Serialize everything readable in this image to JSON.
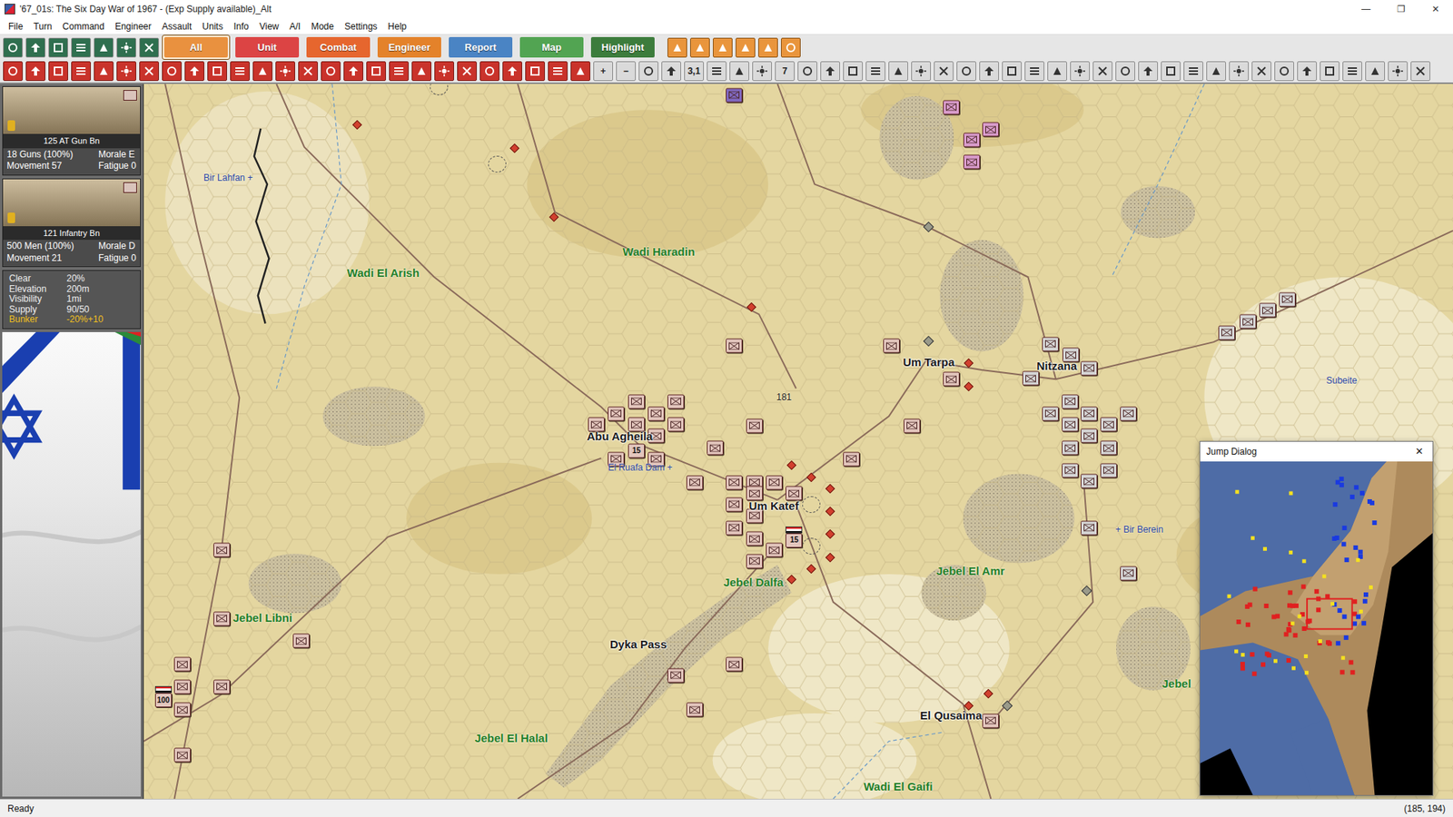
{
  "window": {
    "title": "'67_01s: The Six Day War of 1967 - (Exp Supply available)_Alt",
    "controls": [
      "—",
      "❐",
      "✕"
    ]
  },
  "menu": [
    "File",
    "Turn",
    "Command",
    "Engineer",
    "Assault",
    "Units",
    "Info",
    "View",
    "A/I",
    "Mode",
    "Settings",
    "Help"
  ],
  "tabs": [
    {
      "label": "All",
      "selected": true,
      "color": "#e9913f"
    },
    {
      "label": "Unit",
      "selected": false,
      "color": "#dc4444"
    },
    {
      "label": "Combat",
      "selected": false,
      "color": "#e6662e"
    },
    {
      "label": "Engineer",
      "selected": false,
      "color": "#e4822a"
    },
    {
      "label": "Report",
      "selected": false,
      "color": "#4a84c4"
    },
    {
      "label": "Map",
      "selected": false,
      "color": "#52a452"
    },
    {
      "label": "Highlight",
      "selected": false,
      "color": "#3c7c3c"
    }
  ],
  "toolbar2": [
    {
      "kind": "red"
    },
    {
      "kind": "red"
    },
    {
      "kind": "red"
    },
    {
      "kind": "red"
    },
    {
      "kind": "red"
    },
    {
      "kind": "red"
    },
    {
      "kind": "red"
    },
    {
      "kind": "red"
    },
    {
      "kind": "red"
    },
    {
      "kind": "red"
    },
    {
      "kind": "red"
    },
    {
      "kind": "red"
    },
    {
      "kind": "red"
    },
    {
      "kind": "red"
    },
    {
      "kind": "red"
    },
    {
      "kind": "red"
    },
    {
      "kind": "red"
    },
    {
      "kind": "red"
    },
    {
      "kind": "red"
    },
    {
      "kind": "red"
    },
    {
      "kind": "red"
    },
    {
      "kind": "red"
    },
    {
      "kind": "red"
    },
    {
      "kind": "red"
    },
    {
      "kind": "red"
    },
    {
      "kind": "red"
    },
    {
      "kind": "text",
      "label": "+"
    },
    {
      "kind": "text",
      "label": "−"
    },
    {
      "kind": "grey"
    },
    {
      "kind": "grey"
    },
    {
      "kind": "text",
      "label": "3,1"
    },
    {
      "kind": "grey"
    },
    {
      "kind": "grey"
    },
    {
      "kind": "grey"
    },
    {
      "kind": "text",
      "label": "7"
    },
    {
      "kind": "grey"
    },
    {
      "kind": "grey"
    },
    {
      "kind": "grey"
    },
    {
      "kind": "grey"
    },
    {
      "kind": "grey"
    },
    {
      "kind": "grey"
    },
    {
      "kind": "grey"
    },
    {
      "kind": "grey"
    },
    {
      "kind": "grey"
    },
    {
      "kind": "grey"
    },
    {
      "kind": "grey"
    },
    {
      "kind": "grey"
    },
    {
      "kind": "grey"
    },
    {
      "kind": "grey"
    },
    {
      "kind": "grey"
    },
    {
      "kind": "grey"
    },
    {
      "kind": "grey"
    },
    {
      "kind": "grey"
    },
    {
      "kind": "grey"
    },
    {
      "kind": "grey"
    },
    {
      "kind": "grey"
    },
    {
      "kind": "grey"
    },
    {
      "kind": "grey"
    },
    {
      "kind": "grey"
    },
    {
      "kind": "grey"
    },
    {
      "kind": "grey"
    },
    {
      "kind": "grey"
    },
    {
      "kind": "grey"
    }
  ],
  "unit_cards": [
    {
      "name": "125 AT Gun Bn",
      "strength": "18 Guns (100%)",
      "morale": "Morale E",
      "movement": "Movement 57",
      "fatigue": "Fatigue 0"
    },
    {
      "name": "121 Infantry Bn",
      "strength": "500 Men (100%)",
      "morale": "Morale D",
      "movement": "Movement 21",
      "fatigue": "Fatigue 0"
    }
  ],
  "hex_info": [
    {
      "label": "Clear",
      "value": "20%",
      "highlight": false
    },
    {
      "label": "Elevation",
      "value": "200m",
      "highlight": false
    },
    {
      "label": "Visibility",
      "value": "1mi",
      "highlight": false
    },
    {
      "label": "Supply",
      "value": "90/50",
      "highlight": false
    },
    {
      "label": "Bunker",
      "value": "-20%+10",
      "highlight": true
    }
  ],
  "map": {
    "labels": [
      {
        "text": "Bir Lahfan +",
        "kind": "site"
      },
      {
        "text": "Wadi El Arish",
        "kind": "terrain"
      },
      {
        "text": "Wadi Haradin",
        "kind": "terrain"
      },
      {
        "text": "Um Tarpa",
        "kind": "town"
      },
      {
        "text": "Nitzana",
        "kind": "town"
      },
      {
        "text": "Subeite",
        "kind": "site"
      },
      {
        "text": "Abu Agheila",
        "kind": "town"
      },
      {
        "text": "El Ruafa Dam +",
        "kind": "site"
      },
      {
        "text": "Um Katef",
        "kind": "town"
      },
      {
        "text": "181",
        "kind": "spot"
      },
      {
        "text": "+ Bir Berein",
        "kind": "site"
      },
      {
        "text": "Jebel El Amr",
        "kind": "terrain"
      },
      {
        "text": "Jebel Dalfa",
        "kind": "terrain"
      },
      {
        "text": "Jebel Libni",
        "kind": "terrain"
      },
      {
        "text": "Dyka Pass",
        "kind": "town"
      },
      {
        "text": "Jebel El Halal",
        "kind": "terrain"
      },
      {
        "text": "El Qusaima",
        "kind": "town"
      },
      {
        "text": "Wadi El Gaifi",
        "kind": "terrain"
      },
      {
        "text": "Jebel",
        "kind": "terrain"
      }
    ],
    "units": [
      {
        "kind": "unit",
        "color": "#8068c0"
      },
      {
        "kind": "unit",
        "color": "#d99ccc"
      },
      {
        "kind": "unit",
        "color": "#d99ccc"
      },
      {
        "kind": "unit",
        "color": "#d99ccc"
      },
      {
        "kind": "unit",
        "color": "#d99ccc"
      },
      {
        "kind": "unit",
        "color": "#e3c6bd"
      },
      {
        "kind": "unit",
        "color": "#e3c6bd"
      },
      {
        "kind": "unit",
        "color": "#e3c6bd"
      },
      {
        "kind": "unit",
        "color": "#e3c6bd"
      },
      {
        "kind": "unit",
        "color": "#e3c6bd"
      },
      {
        "kind": "unit",
        "color": "#e3c6bd"
      },
      {
        "kind": "unit",
        "color": "#e3c6bd"
      },
      {
        "kind": "unit",
        "color": "#e3c6bd"
      },
      {
        "kind": "unit",
        "color": "#e3c6bd"
      },
      {
        "kind": "unit",
        "color": "#e3c6bd"
      },
      {
        "kind": "unit",
        "color": "#e3c6bd"
      },
      {
        "kind": "unit",
        "color": "#e3c6bd"
      },
      {
        "kind": "unit",
        "color": "#e3c6bd"
      },
      {
        "kind": "unit",
        "color": "#e3c6bd"
      },
      {
        "kind": "unit",
        "color": "#e3c6bd"
      },
      {
        "kind": "unit",
        "color": "#e3c6bd"
      },
      {
        "kind": "unit",
        "color": "#e3c6bd",
        "label": "15"
      },
      {
        "kind": "unit",
        "color": "#e3c6bd"
      },
      {
        "kind": "unit",
        "color": "#e3c6bd"
      },
      {
        "kind": "unit",
        "color": "#e3c6bd"
      },
      {
        "kind": "unit",
        "color": "#e3c6bd"
      },
      {
        "kind": "unit",
        "color": "#e3c6bd"
      },
      {
        "kind": "unit",
        "color": "#e3c6bd"
      },
      {
        "kind": "unit",
        "color": "#e3c6bd"
      },
      {
        "kind": "unit",
        "color": "#e3c6bd"
      },
      {
        "kind": "unit",
        "color": "#e3c6bd"
      },
      {
        "kind": "unit",
        "color": "#e3c6bd"
      },
      {
        "kind": "unit",
        "color": "#e3c6bd"
      },
      {
        "kind": "unit",
        "color": "#e3c6bd"
      },
      {
        "kind": "unit",
        "color": "#e3c6bd"
      },
      {
        "kind": "hq",
        "color": "#e3c6bd",
        "label": "15"
      },
      {
        "kind": "unit",
        "color": "#d6d6d6"
      },
      {
        "kind": "unit",
        "color": "#d6d6d6"
      },
      {
        "kind": "unit",
        "color": "#d6d6d6"
      },
      {
        "kind": "unit",
        "color": "#d6d6d6"
      },
      {
        "kind": "unit",
        "color": "#d6d6d6"
      },
      {
        "kind": "unit",
        "color": "#d6d6d6"
      },
      {
        "kind": "unit",
        "color": "#d6d6d6"
      },
      {
        "kind": "unit",
        "color": "#d6d6d6"
      },
      {
        "kind": "unit",
        "color": "#d6d6d6"
      },
      {
        "kind": "unit",
        "color": "#d6d6d6"
      },
      {
        "kind": "unit",
        "color": "#d6d6d6"
      },
      {
        "kind": "unit",
        "color": "#d6d6d6"
      },
      {
        "kind": "unit",
        "color": "#d6d6d6"
      },
      {
        "kind": "unit",
        "color": "#d6d6d6"
      },
      {
        "kind": "unit",
        "color": "#d6d6d6"
      },
      {
        "kind": "unit",
        "color": "#d6d6d6"
      },
      {
        "kind": "unit",
        "color": "#d6d6d6"
      },
      {
        "kind": "unit",
        "color": "#d6d6d6"
      },
      {
        "kind": "unit",
        "color": "#d6d6d6"
      },
      {
        "kind": "unit",
        "color": "#d6d6d6"
      },
      {
        "kind": "unit",
        "color": "#d6d6d6"
      },
      {
        "kind": "unit",
        "color": "#d6d6d6"
      },
      {
        "kind": "unit",
        "color": "#e3c6bd"
      },
      {
        "kind": "unit",
        "color": "#e3c6bd"
      },
      {
        "kind": "unit",
        "color": "#e3c6bd"
      },
      {
        "kind": "unit",
        "color": "#e3c6bd"
      },
      {
        "kind": "unit",
        "color": "#e3c6bd"
      },
      {
        "kind": "unit",
        "color": "#e3c6bd"
      },
      {
        "kind": "unit",
        "color": "#e3c6bd"
      },
      {
        "kind": "unit",
        "color": "#e3c6bd"
      },
      {
        "kind": "hq",
        "color": "#e3c6bd",
        "label": "100"
      },
      {
        "kind": "unit",
        "color": "#e3c6bd"
      },
      {
        "kind": "unit",
        "color": "#e3c6bd"
      },
      {
        "kind": "unit",
        "color": "#e3c6bd"
      },
      {
        "kind": "unit",
        "color": "#e3c6bd"
      }
    ]
  },
  "jump_dialog": {
    "title": "Jump Dialog",
    "close": "✕"
  },
  "status_bar": {
    "text": "Ready",
    "coords": "(185, 194)"
  }
}
